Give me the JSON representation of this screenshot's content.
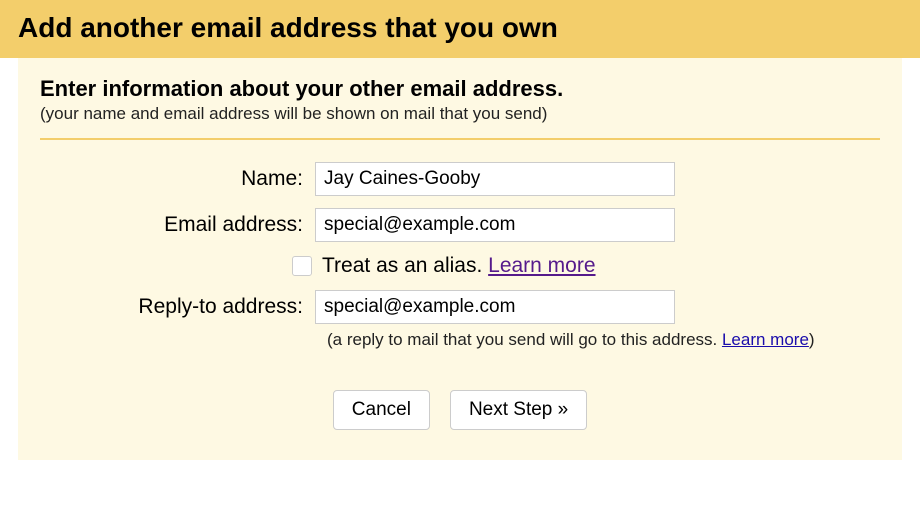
{
  "header": {
    "title": "Add another email address that you own"
  },
  "section": {
    "title": "Enter information about your other email address.",
    "subtitle": "(your name and email address will be shown on mail that you send)"
  },
  "form": {
    "name_label": "Name:",
    "name_value": "Jay Caines-Gooby",
    "email_label": "Email address:",
    "email_value": "special@example.com",
    "alias_label": "Treat as an alias. ",
    "alias_learn_more": "Learn more",
    "replyto_label": "Reply-to address:",
    "replyto_value": "special@example.com",
    "replyto_helper_prefix": "(a reply to mail that you send will go to this address. ",
    "replyto_learn_more": "Learn more",
    "replyto_helper_suffix": ")"
  },
  "buttons": {
    "cancel": "Cancel",
    "next": "Next Step »"
  }
}
